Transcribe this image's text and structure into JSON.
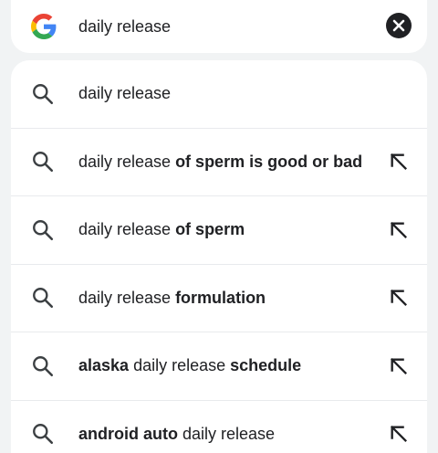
{
  "search": {
    "value": "daily release",
    "logo_icon": "google-g-icon",
    "clear_icon": "close-icon"
  },
  "suggestions": [
    {
      "parts": [
        {
          "text": "daily release",
          "bold": false
        }
      ],
      "fill_arrow": false
    },
    {
      "parts": [
        {
          "text": "daily release ",
          "bold": false
        },
        {
          "text": "of sperm is good or bad",
          "bold": true
        }
      ],
      "fill_arrow": true
    },
    {
      "parts": [
        {
          "text": "daily release ",
          "bold": false
        },
        {
          "text": "of sperm",
          "bold": true
        }
      ],
      "fill_arrow": true
    },
    {
      "parts": [
        {
          "text": "daily release ",
          "bold": false
        },
        {
          "text": "formulation",
          "bold": true
        }
      ],
      "fill_arrow": true
    },
    {
      "parts": [
        {
          "text": "alaska",
          "bold": true
        },
        {
          "text": " daily release ",
          "bold": false
        },
        {
          "text": "schedule",
          "bold": true
        }
      ],
      "fill_arrow": true
    },
    {
      "parts": [
        {
          "text": "android auto",
          "bold": true
        },
        {
          "text": " daily release",
          "bold": false
        }
      ],
      "fill_arrow": true
    }
  ],
  "colors": {
    "page_bg": "#f1f3f4",
    "card_bg": "#ffffff",
    "text": "#202124",
    "icon": "#3c4043",
    "divider": "#e8eaed"
  }
}
